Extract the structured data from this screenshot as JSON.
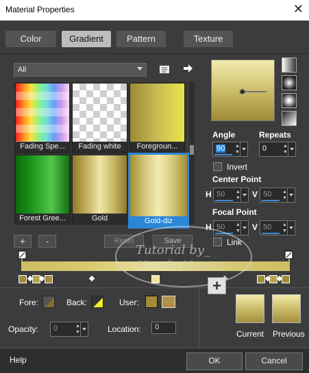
{
  "window": {
    "title": "Material Properties",
    "close_glyph": "✕"
  },
  "tabs": [
    {
      "label": "Color",
      "active": false
    },
    {
      "label": "Gradient",
      "active": true
    },
    {
      "label": "Pattern",
      "active": false
    },
    {
      "label": "Texture",
      "active": false
    }
  ],
  "library": {
    "category_value": "All",
    "gradients": [
      {
        "label": "Fading Spe...",
        "selected": false
      },
      {
        "label": "Fading white",
        "selected": false
      },
      {
        "label": "Foregroun...",
        "selected": false
      },
      {
        "label": "Forest Gree...",
        "selected": false
      },
      {
        "label": "Gold",
        "selected": false
      },
      {
        "label": "Gold-diz",
        "selected": true
      }
    ],
    "add_label": "+",
    "remove_label": "-",
    "reset_label": "Reset",
    "save_label": "Save"
  },
  "watermark": {
    "line1": "Tutorial by_",
    "line2": "Nataša Novaes"
  },
  "settings": {
    "angle_label": "Angle",
    "angle_value": "90",
    "repeats_label": "Repeats",
    "repeats_value": "0",
    "invert_label": "Invert",
    "center_point_label": "Center Point",
    "center_h_label": "H",
    "center_h_value": "50",
    "center_v_label": "V",
    "center_v_value": "50",
    "focal_point_label": "Focal Point",
    "focal_h_label": "H",
    "focal_h_value": "50",
    "focal_v_label": "V",
    "focal_v_value": "50",
    "link_label": "Link"
  },
  "stops": {
    "fore_label": "Fore:",
    "back_label": "Back:",
    "user_label": "User:",
    "opacity_label": "Opacity:",
    "opacity_value": "0",
    "location_label": "Location:",
    "location_value": "0"
  },
  "preview": {
    "add_label": "+",
    "current_label": "Current",
    "previous_label": "Previous"
  },
  "footer": {
    "help_label": "Help",
    "ok_label": "OK",
    "cancel_label": "Cancel"
  },
  "colors": {
    "gold_light": "#e6e29a",
    "gold_mid": "#c7b660",
    "gold_dark": "#8d7a28",
    "selection": "#2b86d6"
  }
}
